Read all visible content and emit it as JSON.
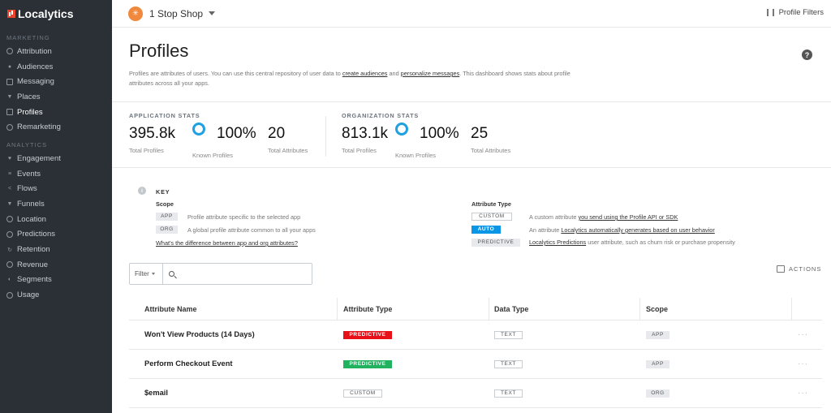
{
  "brand": {
    "name": "Localytics"
  },
  "sidebar": {
    "marketing_label": "MARKETING",
    "marketing_items": [
      {
        "label": "Attribution",
        "icon": "attribution-icon"
      },
      {
        "label": "Audiences",
        "icon": "audiences-icon"
      },
      {
        "label": "Messaging",
        "icon": "messaging-icon"
      },
      {
        "label": "Places",
        "icon": "places-icon"
      },
      {
        "label": "Profiles",
        "icon": "profiles-icon"
      },
      {
        "label": "Remarketing",
        "icon": "remarketing-icon"
      }
    ],
    "analytics_label": "ANALYTICS",
    "analytics_items": [
      {
        "label": "Engagement",
        "icon": "heart-icon"
      },
      {
        "label": "Events",
        "icon": "list-icon"
      },
      {
        "label": "Flows",
        "icon": "flows-icon"
      },
      {
        "label": "Funnels",
        "icon": "funnel-icon"
      },
      {
        "label": "Location",
        "icon": "globe-icon"
      },
      {
        "label": "Predictions",
        "icon": "predictions-icon"
      },
      {
        "label": "Retention",
        "icon": "retention-icon"
      },
      {
        "label": "Revenue",
        "icon": "revenue-icon"
      },
      {
        "label": "Segments",
        "icon": "segments-icon"
      },
      {
        "label": "Usage",
        "icon": "usage-icon"
      }
    ]
  },
  "topbar": {
    "app_name": "1 Stop Shop",
    "profile_filters": "Profile Filters"
  },
  "page": {
    "title": "Profiles",
    "help": "?",
    "desc_1": "Profiles are attributes of users. You can use this central repository of user data to ",
    "desc_link_1": "create audiences",
    "desc_2": " and ",
    "desc_link_2": "personalize messages",
    "desc_3": ". This dashboard shows stats about profile attributes across all your apps."
  },
  "stats": {
    "app": {
      "label": "APPLICATION STATS",
      "total_profiles": "395.8k",
      "total_profiles_caption": "Total Profiles",
      "known_profiles": "100%",
      "known_profiles_caption": "Known Profiles",
      "total_attributes": "20",
      "total_attributes_caption": "Total Attributes"
    },
    "org": {
      "label": "ORGANIZATION STATS",
      "total_profiles": "813.1k",
      "total_profiles_caption": "Total Profiles",
      "known_profiles": "100%",
      "known_profiles_caption": "Known Profiles",
      "total_attributes": "25",
      "total_attributes_caption": "Total Attributes"
    }
  },
  "key": {
    "title": "KEY",
    "scope_label": "Scope",
    "app_tag": "APP",
    "app_desc": "Profile attribute specific to the selected app",
    "org_tag": "ORG",
    "org_desc": "A global profile attribute common to all your apps",
    "diff_link": "What's the difference between app and org attributes?",
    "type_label": "Attribute Type",
    "custom_tag": "CUSTOM",
    "custom_desc": "A custom attribute ",
    "custom_link": "you send using the Profile API or SDK",
    "auto_tag": "AUTO",
    "auto_desc": "An attribute ",
    "auto_link": "Localytics automatically generates based on user behavior",
    "predictive_tag": "PREDICTIVE",
    "predictive_link": "Localytics Predictions",
    "predictive_desc": " user attribute, such as churn risk or purchase propensity"
  },
  "filter": {
    "label": "Filter",
    "search_value": ""
  },
  "actions": {
    "label": "ACTIONS"
  },
  "table": {
    "headers": [
      "Attribute Name",
      "Attribute Type",
      "Data Type",
      "Scope"
    ],
    "rows": [
      {
        "name": "Won't View Products (14 Days)",
        "type": "PREDICTIVE",
        "type_color": "#e8111a",
        "data_type": "TEXT",
        "scope": "APP"
      },
      {
        "name": "Perform Checkout Event",
        "type": "PREDICTIVE",
        "type_color": "#20b25f",
        "data_type": "TEXT",
        "scope": "APP"
      },
      {
        "name": "$email",
        "type": "CUSTOM",
        "type_color": "",
        "data_type": "TEXT",
        "scope": "ORG"
      }
    ],
    "more": "···"
  }
}
